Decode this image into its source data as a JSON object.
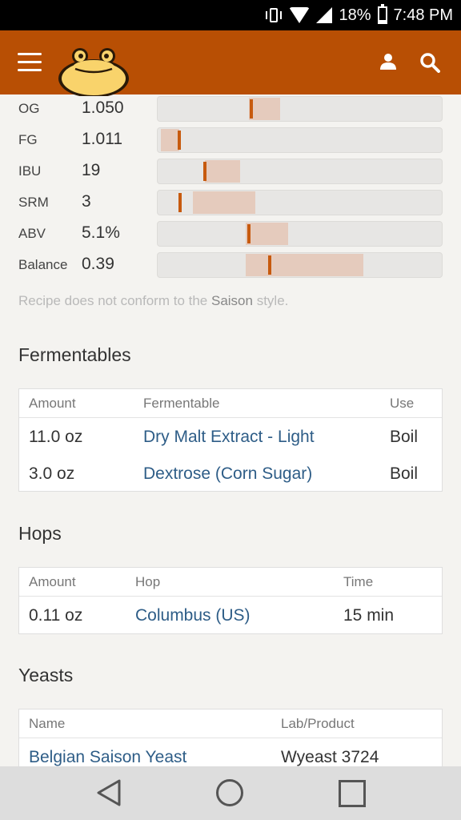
{
  "status_bar": {
    "battery": "18%",
    "time": "7:48 PM"
  },
  "colors": {
    "brand": "#b84f04",
    "marker": "#c75a0e",
    "range": "#e5cbbd",
    "link": "#2e5d87"
  },
  "header": {
    "menu_icon": "hamburger-menu-icon",
    "logo": "toad-logo",
    "user_icon": "user-icon",
    "search_icon": "search-icon"
  },
  "stats": [
    {
      "label": "OG",
      "value": "1.050",
      "range_start_pct": 32.0,
      "range_end_pct": 43.0,
      "marker_pct": 33.0
    },
    {
      "label": "FG",
      "value": "1.011",
      "range_start_pct": 1.0,
      "range_end_pct": 7.5,
      "marker_pct": 7.5
    },
    {
      "label": "IBU",
      "value": "19",
      "range_start_pct": 16.5,
      "range_end_pct": 29.0,
      "marker_pct": 16.5
    },
    {
      "label": "SRM",
      "value": "3",
      "range_start_pct": 12.5,
      "range_end_pct": 34.5,
      "marker_pct": 7.8
    },
    {
      "label": "ABV",
      "value": "5.1%",
      "range_start_pct": 31.0,
      "range_end_pct": 46.0,
      "marker_pct": 32.0
    },
    {
      "label": "Balance",
      "value": "0.39",
      "range_start_pct": 31.0,
      "range_end_pct": 72.5,
      "marker_pct": 39.5
    }
  ],
  "conformance": {
    "prefix": "Recipe does not conform to the ",
    "style": "Saison",
    "suffix": " style."
  },
  "fermentables": {
    "title": "Fermentables",
    "headers": [
      "Amount",
      "Fermentable",
      "Use"
    ],
    "rows": [
      {
        "amount": "11.0 oz",
        "name": "Dry Malt Extract - Light",
        "use": "Boil"
      },
      {
        "amount": "3.0 oz",
        "name": "Dextrose (Corn Sugar)",
        "use": "Boil"
      }
    ]
  },
  "hops": {
    "title": "Hops",
    "headers": [
      "Amount",
      "Hop",
      "Time"
    ],
    "rows": [
      {
        "amount": "0.11 oz",
        "name": "Columbus (US)",
        "time": "15 min"
      }
    ]
  },
  "yeasts": {
    "title": "Yeasts",
    "headers": [
      "Name",
      "Lab/Product"
    ],
    "rows": [
      {
        "name": "Belgian Saison Yeast",
        "lab": "Wyeast 3724"
      }
    ]
  },
  "nav": {
    "back_icon": "back-triangle-icon",
    "home_icon": "home-circle-icon",
    "recents_icon": "recents-square-icon"
  }
}
